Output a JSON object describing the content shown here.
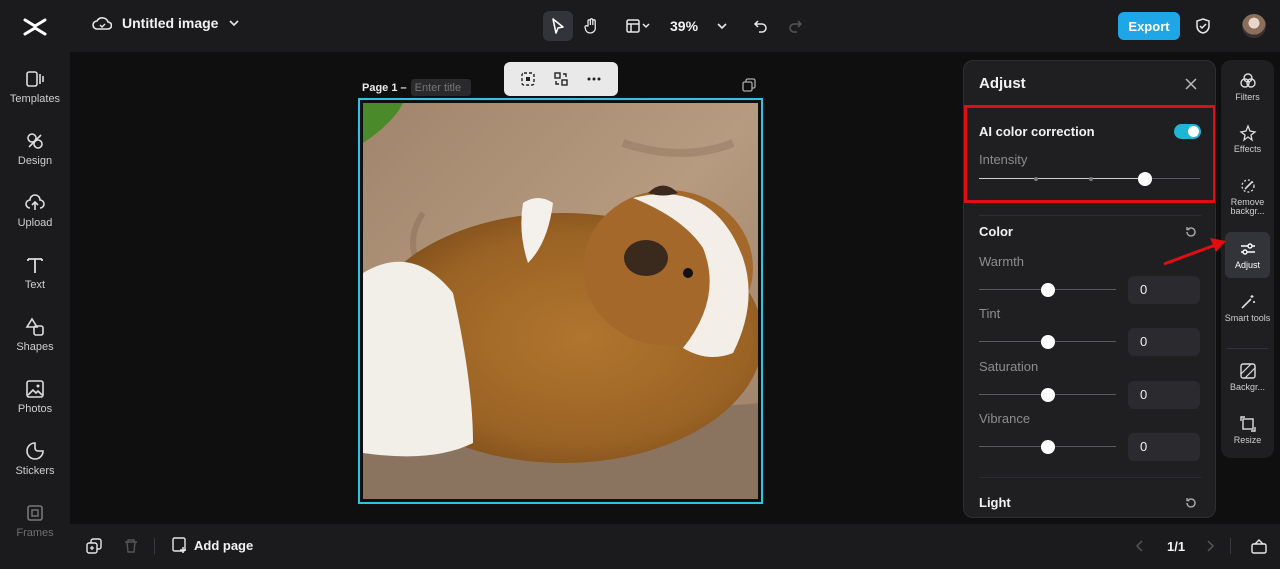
{
  "sidebar": {
    "items": [
      {
        "label": "Templates",
        "icon": "templates-icon"
      },
      {
        "label": "Design",
        "icon": "design-icon"
      },
      {
        "label": "Upload",
        "icon": "upload-icon"
      },
      {
        "label": "Text",
        "icon": "text-icon"
      },
      {
        "label": "Shapes",
        "icon": "shapes-icon"
      },
      {
        "label": "Photos",
        "icon": "photos-icon"
      },
      {
        "label": "Stickers",
        "icon": "stickers-icon"
      },
      {
        "label": "Frames",
        "icon": "frames-icon"
      }
    ]
  },
  "header": {
    "title": "Untitled image",
    "zoom": "39%",
    "export_label": "Export"
  },
  "canvas": {
    "page_label": "Page 1 –",
    "title_placeholder": "Enter title"
  },
  "adjust_panel": {
    "title": "Adjust",
    "ai_color_correction": {
      "label": "AI color correction",
      "enabled": true
    },
    "intensity": {
      "label": "Intensity",
      "value": 0.75
    },
    "color": {
      "title": "Color",
      "warmth": {
        "label": "Warmth",
        "value": "0"
      },
      "tint": {
        "label": "Tint",
        "value": "0"
      },
      "saturation": {
        "label": "Saturation",
        "value": "0"
      },
      "vibrance": {
        "label": "Vibrance",
        "value": "0"
      }
    },
    "light": {
      "title": "Light"
    }
  },
  "rail": {
    "items": [
      {
        "label": "Filters"
      },
      {
        "label": "Effects"
      },
      {
        "label": "Remove backgr..."
      },
      {
        "label": "Adjust"
      },
      {
        "label": "Smart tools"
      },
      {
        "label": "Backgr..."
      },
      {
        "label": "Resize"
      }
    ]
  },
  "footer": {
    "add_page_label": "Add page",
    "page_count": "1/1"
  },
  "colors": {
    "accent": "#1fa6e6",
    "selection": "#2fc4e5",
    "highlight": "#e10d12"
  }
}
